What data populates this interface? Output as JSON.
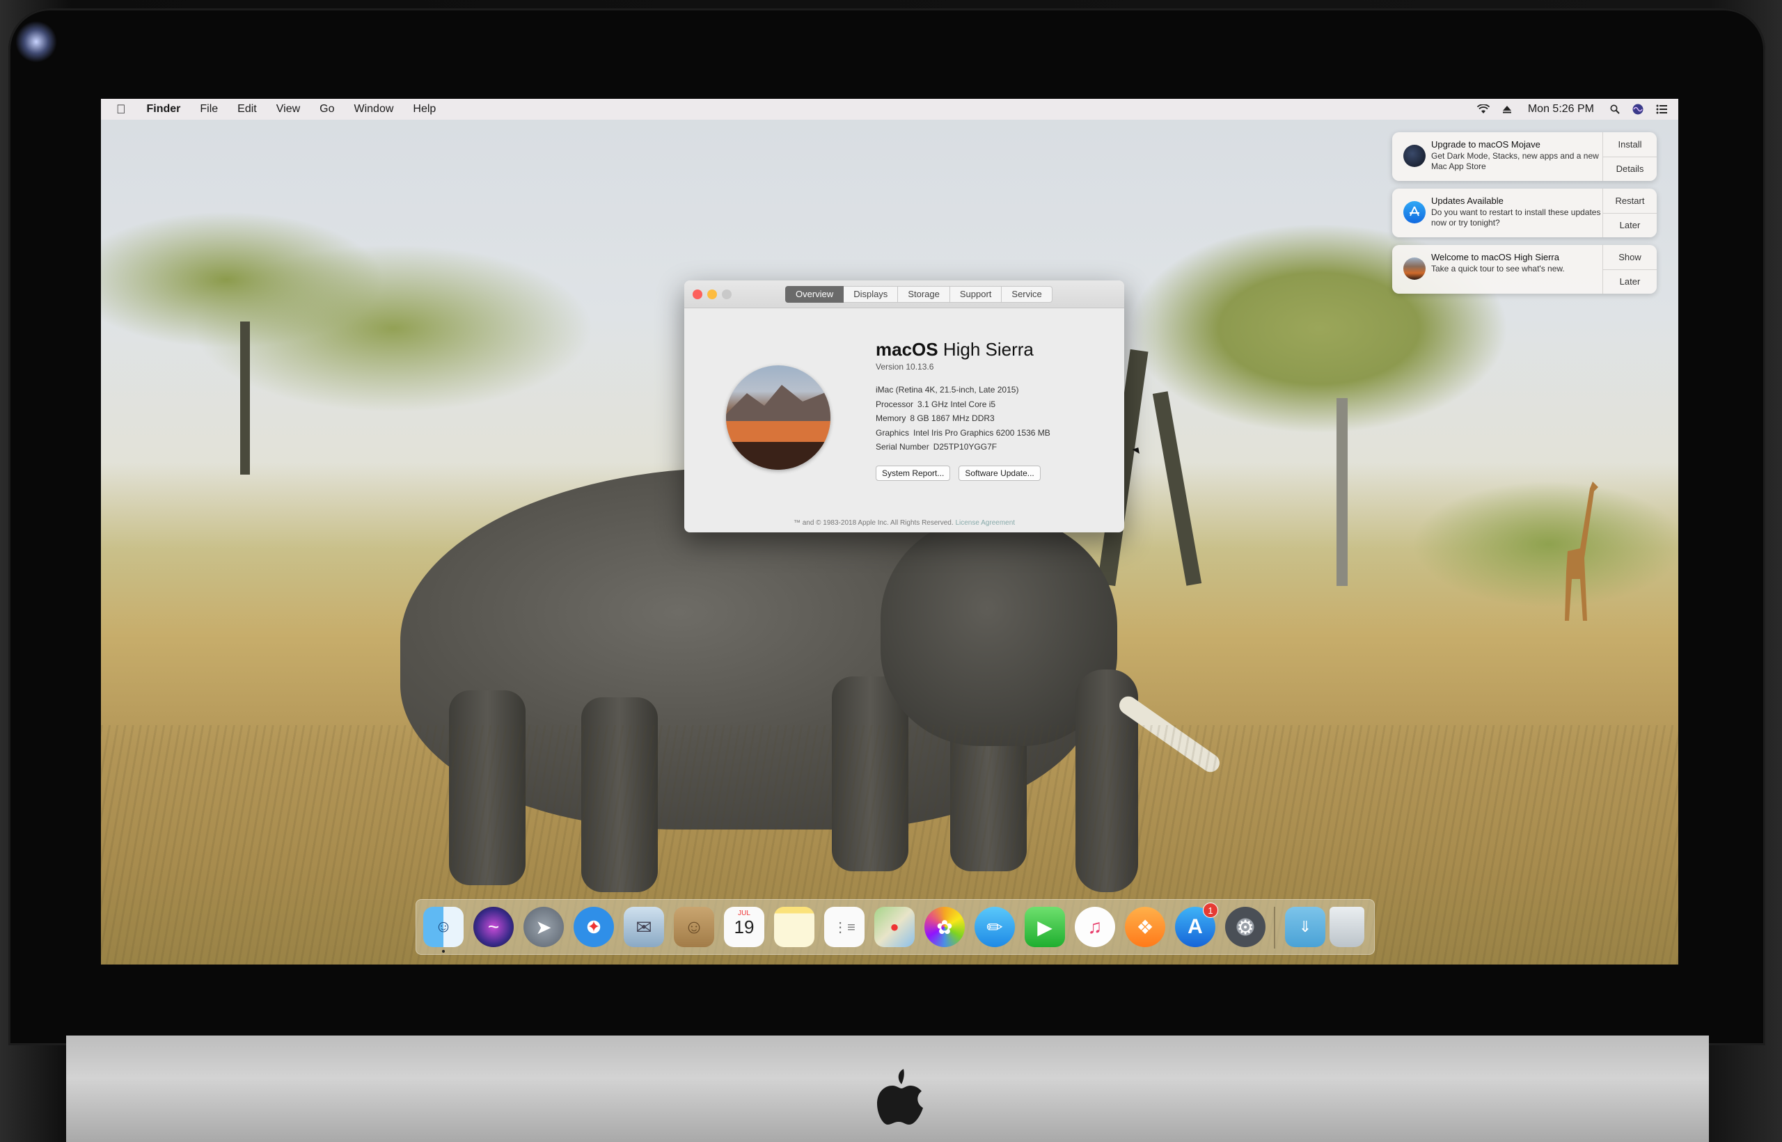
{
  "menubar": {
    "app": "Finder",
    "menus": [
      "File",
      "Edit",
      "View",
      "Go",
      "Window",
      "Help"
    ],
    "clock": "Mon 5:26 PM",
    "icons": [
      "wifi-icon",
      "eject-icon",
      "spotlight-icon",
      "siri-icon",
      "notification-center-icon"
    ]
  },
  "notifications": [
    {
      "title": "Upgrade to macOS Mojave",
      "body": "Get Dark Mode, Stacks, new apps and a new Mac App Store",
      "actions": [
        "Install",
        "Details"
      ],
      "icon": "mojave-icon"
    },
    {
      "title": "Updates Available",
      "body": "Do you want to restart to install these updates now or try tonight?",
      "actions": [
        "Restart",
        "Later"
      ],
      "icon": "app-store-icon"
    },
    {
      "title": "Welcome to macOS High Sierra",
      "body": "Take a quick tour to see what's new.",
      "actions": [
        "Show",
        "Later"
      ],
      "icon": "high-sierra-icon"
    }
  ],
  "about": {
    "tabs": [
      "Overview",
      "Displays",
      "Storage",
      "Support",
      "Service"
    ],
    "active_tab": "Overview",
    "os_name_bold": "macOS",
    "os_name_rest": "High Sierra",
    "version": "Version 10.13.6",
    "model": "iMac (Retina 4K, 21.5-inch, Late 2015)",
    "specs": [
      {
        "key": "Processor",
        "value": "3.1 GHz Intel Core i5"
      },
      {
        "key": "Memory",
        "value": "8 GB 1867 MHz DDR3"
      },
      {
        "key": "Graphics",
        "value": "Intel Iris Pro Graphics 6200 1536 MB"
      },
      {
        "key": "Serial Number",
        "value": "D25TP10YGG7F"
      }
    ],
    "buttons": [
      "System Report...",
      "Software Update..."
    ],
    "footer": "™ and © 1983-2018 Apple Inc. All Rights Reserved.",
    "footer_link": "License Agreement"
  },
  "dock": {
    "items": [
      "Finder",
      "Siri",
      "Launchpad",
      "Safari",
      "Mail",
      "Contacts",
      "Calendar",
      "Notes",
      "Reminders",
      "Maps",
      "Photos",
      "Messages",
      "FaceTime",
      "iTunes",
      "iBooks",
      "App Store",
      "System Preferences",
      "Downloads",
      "Trash"
    ],
    "calendar_month": "JUL",
    "calendar_day": "19",
    "app_store_badge": "1"
  },
  "colors": {
    "menubar": "#eeebec",
    "tab_active": "#6a6a6a",
    "badge": "#e63b33",
    "close": "#fc605c",
    "minimize": "#fdbc40",
    "zoom": "#c9c9c9"
  }
}
